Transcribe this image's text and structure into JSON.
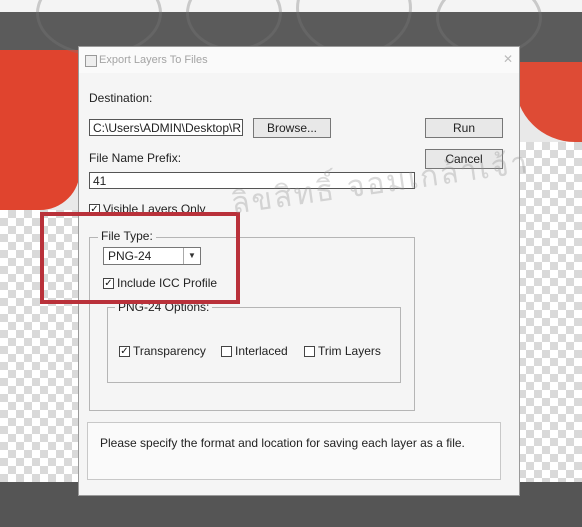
{
  "dialog": {
    "title": "Export Layers To Files",
    "destination_label": "Destination:",
    "destination_value": "C:\\Users\\ADMIN\\Desktop\\R",
    "browse_label": "Browse...",
    "run_label": "Run",
    "cancel_label": "Cancel",
    "prefix_label": "File Name Prefix:",
    "prefix_value": "41",
    "visible_layers_label": "Visible Layers Only",
    "visible_layers_checked": true,
    "file_type": {
      "legend": "File Type:",
      "selected": "PNG-24",
      "include_icc_label": "Include ICC Profile",
      "include_icc_checked": true
    },
    "png_options": {
      "legend": "PNG-24 Options:",
      "transparency_label": "Transparency",
      "transparency_checked": true,
      "interlaced_label": "Interlaced",
      "interlaced_checked": false,
      "trim_label": "Trim Layers",
      "trim_checked": false
    },
    "status_text": "Please specify the format and location for saving each layer as a file."
  },
  "watermark_text": "ลิขสิทธิ์ จอมเกล้าเจ้า",
  "colors": {
    "highlight": "#b9313a",
    "background_red": "#e0442e",
    "background_grey": "#5b5b5b"
  }
}
